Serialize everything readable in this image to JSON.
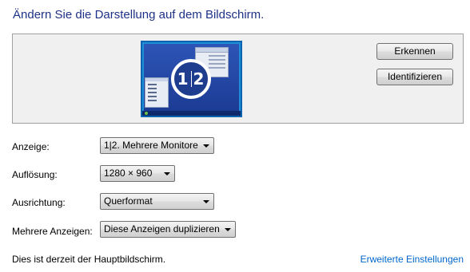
{
  "header": {
    "title": "Ändern Sie die Darstellung auf dem Bildschirm."
  },
  "preview": {
    "monitor_numbers": [
      "1",
      "2"
    ],
    "buttons": {
      "detect": "Erkennen",
      "identify": "Identifizieren"
    }
  },
  "settings": {
    "display": {
      "label": "Anzeige:",
      "value": "1|2. Mehrere Monitore"
    },
    "resolution": {
      "label": "Auflösung:",
      "value": "1280 × 960"
    },
    "orientation": {
      "label": "Ausrichtung:",
      "value": "Querformat"
    },
    "multiple": {
      "label": "Mehrere Anzeigen:",
      "value": "Diese Anzeigen duplizieren"
    }
  },
  "footer": {
    "status": "Dies ist derzeit der Hauptbildschirm.",
    "advanced_link": "Erweiterte Einstellungen"
  },
  "colors": {
    "title": "#1e3287",
    "link": "#0066cc",
    "monitor_frame": "#1e8fd6"
  }
}
